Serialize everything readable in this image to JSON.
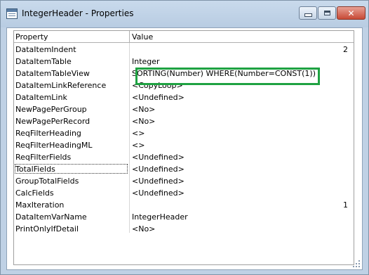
{
  "window": {
    "title": "IntegerHeader - Properties",
    "icon": "table-properties-icon"
  },
  "grid": {
    "columns": [
      "Property",
      "Value"
    ],
    "rows": [
      {
        "property": "DataItemIndent",
        "value": "2",
        "align": "right"
      },
      {
        "property": "DataItemTable",
        "value": "Integer",
        "align": "left"
      },
      {
        "property": "DataItemTableView",
        "value": "SORTING(Number) WHERE(Number=CONST(1))",
        "align": "left",
        "highlighted": true
      },
      {
        "property": "DataItemLinkReference",
        "value": "<CopyLoop>",
        "align": "left"
      },
      {
        "property": "DataItemLink",
        "value": "<Undefined>",
        "align": "left"
      },
      {
        "property": "NewPagePerGroup",
        "value": "<No>",
        "align": "left"
      },
      {
        "property": "NewPagePerRecord",
        "value": "<No>",
        "align": "left"
      },
      {
        "property": "ReqFilterHeading",
        "value": "<>",
        "align": "left"
      },
      {
        "property": "ReqFilterHeadingML",
        "value": "<>",
        "align": "left"
      },
      {
        "property": "ReqFilterFields",
        "value": "<Undefined>",
        "align": "left"
      },
      {
        "property": "TotalFields",
        "value": "<Undefined>",
        "align": "left",
        "focused": true
      },
      {
        "property": "GroupTotalFields",
        "value": "<Undefined>",
        "align": "left"
      },
      {
        "property": "CalcFields",
        "value": "<Undefined>",
        "align": "left"
      },
      {
        "property": "MaxIteration",
        "value": "1",
        "align": "right"
      },
      {
        "property": "DataItemVarName",
        "value": "IntegerHeader",
        "align": "left"
      },
      {
        "property": "PrintOnlyIfDetail",
        "value": "<No>",
        "align": "left"
      }
    ]
  },
  "colors": {
    "highlight_border": "#1fa242",
    "titlebar": "#c2d5ea"
  }
}
